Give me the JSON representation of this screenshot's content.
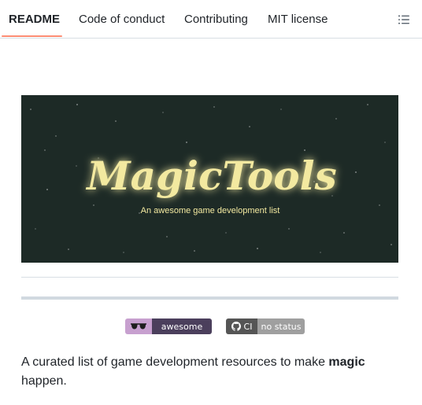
{
  "tabs": [
    {
      "label": "README",
      "active": true
    },
    {
      "label": "Code of conduct",
      "active": false
    },
    {
      "label": "Contributing",
      "active": false
    },
    {
      "label": "MIT license",
      "active": false
    }
  ],
  "outline_icon": "list-unordered-icon",
  "banner": {
    "title": "MagicTools",
    "subtitle": "An awesome game development list"
  },
  "badges": [
    {
      "icon": "sunglasses-icon",
      "label": "awesome"
    },
    {
      "icon": "github-icon",
      "label": "CI",
      "status": "no status"
    }
  ],
  "description": {
    "before": "A curated list of game development resources to make ",
    "bold": "magic",
    "after": " happen."
  },
  "colors": {
    "active_tab_underline": "#fd8c73",
    "banner_bg": "#1d2a26",
    "banner_title": "#f3e9a0"
  }
}
